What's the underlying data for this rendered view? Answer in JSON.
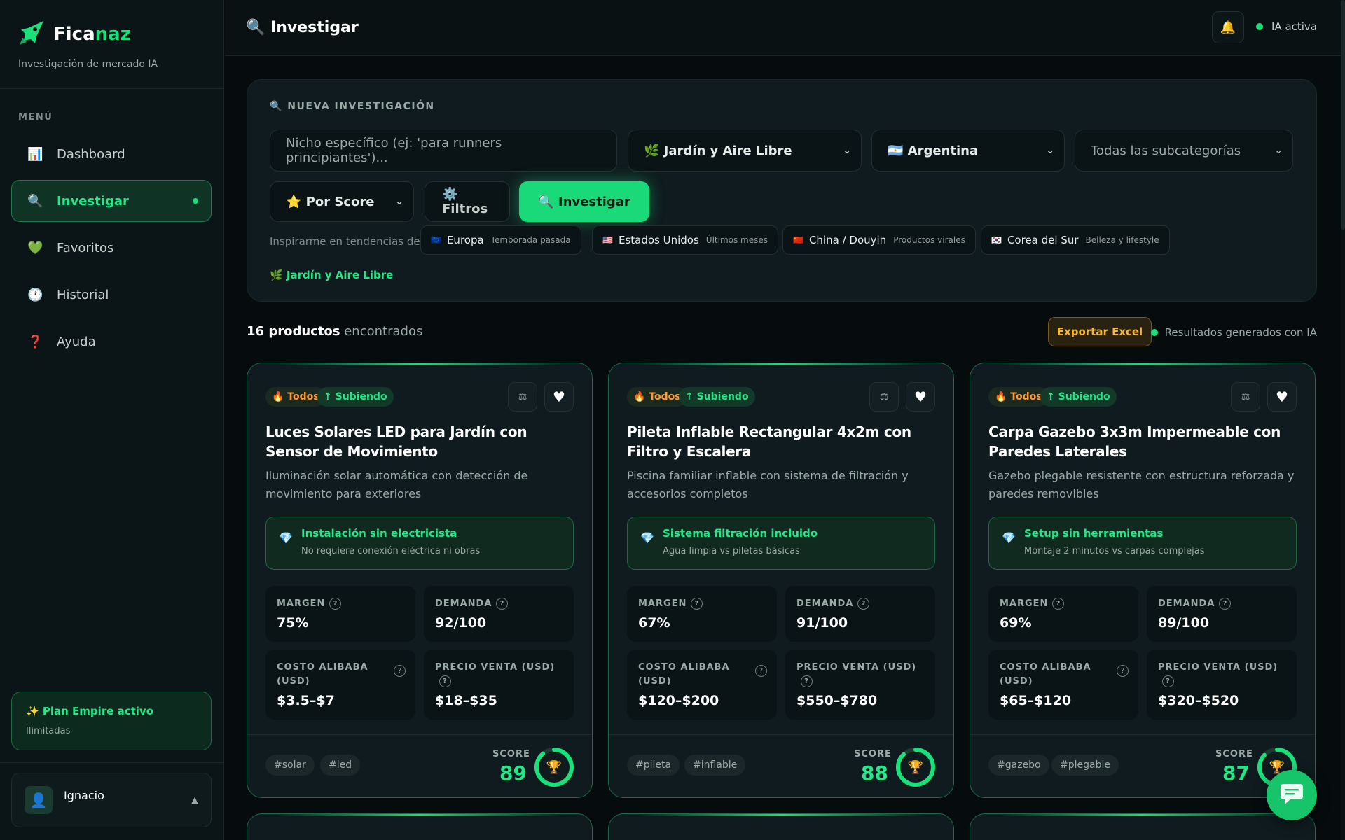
{
  "app": {
    "name_prefix": "Fica",
    "name_accent": "naz",
    "tagline": "Investigación de mercado IA"
  },
  "sidebar": {
    "menu_label": "MENÚ",
    "items": [
      {
        "icon": "📊",
        "label": "Dashboard"
      },
      {
        "icon": "🔍",
        "label": "Investigar"
      },
      {
        "icon": "💚",
        "label": "Favoritos"
      },
      {
        "icon": "🕐",
        "label": "Historial"
      },
      {
        "icon": "❓",
        "label": "Ayuda"
      }
    ],
    "plan_title": "✨ Plan Empire activo",
    "plan_sub": "Ilimitadas",
    "user_name": "Ignacio",
    "user_icon": "👤"
  },
  "topbar": {
    "title": "🔍 Investigar",
    "bell_icon": "🔔",
    "ia_status": "IA activa"
  },
  "search": {
    "panel_title": "🔍 NUEVA INVESTIGACIÓN",
    "niche_placeholder": "Nicho específico (ej: 'para runners principiantes')...",
    "category": "🌿 Jardín y Aire Libre",
    "country": "🇦🇷 Argentina",
    "subcategory": "Todas las subcategorías",
    "sort": "⭐ Por Score",
    "filters_label": "⚙️ Filtros",
    "submit_label": "🔍 Investigar",
    "trend_label": "Inspirarme en tendencias de",
    "trends": [
      {
        "flag": "🇪🇺",
        "name": "Europa",
        "sub": "Temporada pasada"
      },
      {
        "flag": "🇺🇸",
        "name": "Estados Unidos",
        "sub": "Últimos meses"
      },
      {
        "flag": "🇨🇳",
        "name": "China / Douyin",
        "sub": "Productos virales"
      },
      {
        "flag": "🇰🇷",
        "name": "Corea del Sur",
        "sub": "Belleza y lifestyle"
      }
    ],
    "active_category": "🌿 Jardín y Aire Libre"
  },
  "results": {
    "count": "16 productos",
    "count_suffix": " encontrados",
    "export_label": "Exportar Excel",
    "ai_note": "Resultados generados con IA"
  },
  "labels": {
    "margin": "MARGEN",
    "demand": "DEMANDA",
    "cost_line1": "COSTO ALIBABA",
    "cost_line2": "(USD)",
    "price": "PRECIO VENTA (USD)",
    "score": "SCORE",
    "help": "?",
    "compare_icon": "⚖",
    "heart_icon": "♥",
    "gem_icon": "💎",
    "trophy_icon": "🏆"
  },
  "products": [
    {
      "tag_all": "🔥 Todos",
      "tag_trend": "↑ Subiendo",
      "title": "Luces Solares LED para Jardín con Sensor de Movimiento",
      "desc": "Iluminación solar automática con detección de movimiento para exteriores",
      "feature_title": "Instalación sin electricista",
      "feature_sub": "No requiere conexión eléctrica ni obras",
      "margin": "75%",
      "demand": "92/100",
      "cost": "$3.5–$7",
      "price": "$18–$35",
      "hashtags": [
        "#solar",
        "#led"
      ],
      "score": "89"
    },
    {
      "tag_all": "🔥 Todos",
      "tag_trend": "↑ Subiendo",
      "title": "Pileta Inflable Rectangular 4x2m con Filtro y Escalera",
      "desc": "Piscina familiar inflable con sistema de filtración y accesorios completos",
      "feature_title": "Sistema filtración incluido",
      "feature_sub": "Agua limpia vs piletas básicas",
      "margin": "67%",
      "demand": "91/100",
      "cost": "$120–$200",
      "price": "$550–$780",
      "hashtags": [
        "#pileta",
        "#inflable"
      ],
      "score": "88"
    },
    {
      "tag_all": "🔥 Todos",
      "tag_trend": "↑ Subiendo",
      "title": "Carpa Gazebo 3x3m Impermeable con Paredes Laterales",
      "desc": "Gazebo plegable resistente con estructura reforzada y paredes removibles",
      "feature_title": "Setup sin herramientas",
      "feature_sub": "Montaje 2 minutos vs carpas complejas",
      "margin": "69%",
      "demand": "89/100",
      "cost": "$65–$120",
      "price": "$320–$520",
      "hashtags": [
        "#gazebo",
        "#plegable"
      ],
      "score": "87"
    }
  ],
  "colors": {
    "accent": "#19e07a",
    "background": "#060b0d",
    "card": "#0f1b1e",
    "export": "#f4b733"
  }
}
